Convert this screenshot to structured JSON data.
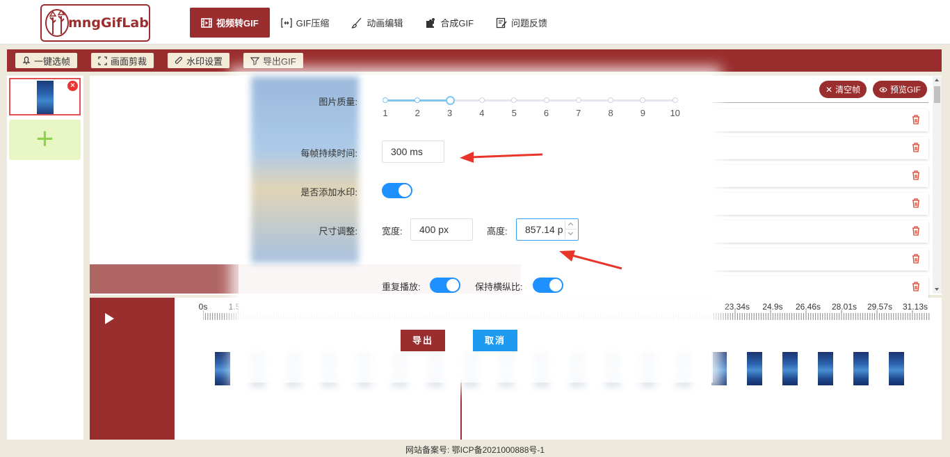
{
  "header": {
    "logo_text": "mngGifLab",
    "nav": [
      {
        "label": "视频转GIF",
        "icon": "film-icon",
        "active": true
      },
      {
        "label": "GIF压缩",
        "icon": "compress-icon",
        "active": false
      },
      {
        "label": "动画编辑",
        "icon": "brush-icon",
        "active": false
      },
      {
        "label": "合成GIF",
        "icon": "puzzle-icon",
        "active": false
      },
      {
        "label": "问题反馈",
        "icon": "feedback-icon",
        "active": false
      }
    ]
  },
  "toolbar": {
    "buttons": [
      {
        "label": "一键选帧",
        "icon": "pin-icon"
      },
      {
        "label": "画面剪裁",
        "icon": "crop-icon"
      },
      {
        "label": "水印设置",
        "icon": "paperclip-icon"
      },
      {
        "label": "导出GIF",
        "icon": "filter-icon"
      }
    ]
  },
  "right_actions": {
    "clear_label": "清空帧",
    "preview_label": "预览GIF"
  },
  "modal": {
    "quality_label": "图片质量:",
    "quality_value": 3,
    "quality_scale": [
      "1",
      "2",
      "3",
      "4",
      "5",
      "6",
      "7",
      "8",
      "9",
      "10"
    ],
    "duration_label": "每帧持续时间:",
    "duration_value": "300 ms",
    "watermark_label": "是否添加水印:",
    "watermark_on": true,
    "size_label": "尺寸调整:",
    "width_label": "宽度:",
    "width_value": "400 px",
    "height_label": "高度:",
    "height_value": "857.14 p",
    "repeat_label": "重复播放:",
    "repeat_on": true,
    "keep_ratio_label": "保持横纵比:",
    "keep_ratio_on": true,
    "export_label": "导出",
    "cancel_label": "取消"
  },
  "timeline": {
    "ticks": [
      "0s",
      "1.5",
      "23.34s",
      "24.9s",
      "26.46s",
      "28.01s",
      "29.57s",
      "31.13s"
    ]
  },
  "footer": {
    "text": "网站备案号: 鄂ICP备2021000888号-1"
  },
  "colors": {
    "brand": "#9a2d2d",
    "accent": "#1e90ff",
    "cancel": "#1e9bf0",
    "arrow": "#e8352a"
  }
}
